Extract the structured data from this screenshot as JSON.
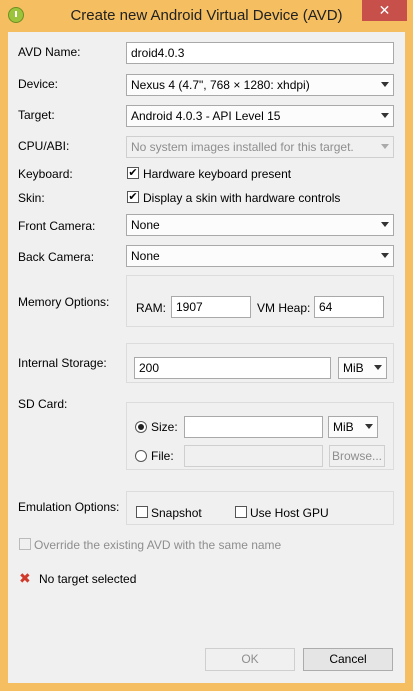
{
  "window": {
    "title": "Create new Android Virtual Device (AVD)",
    "close_glyph": "✕"
  },
  "labels": {
    "avd_name": "AVD Name:",
    "device": "Device:",
    "target": "Target:",
    "cpu_abi": "CPU/ABI:",
    "keyboard": "Keyboard:",
    "skin": "Skin:",
    "front_camera": "Front Camera:",
    "back_camera": "Back Camera:",
    "memory_options": "Memory Options:",
    "internal_storage": "Internal Storage:",
    "sd_card": "SD Card:",
    "emulation_options": "Emulation Options:"
  },
  "fields": {
    "avd_name": "droid4.0.3",
    "device": "Nexus 4 (4.7\", 768 × 1280: xhdpi)",
    "target": "Android 4.0.3 - API Level 15",
    "cpu_abi": "No system images installed for this target.",
    "front_camera": "None",
    "back_camera": "None"
  },
  "keyboard": {
    "label": "Hardware keyboard present",
    "checked": true
  },
  "skin": {
    "label": "Display a skin with hardware controls",
    "checked": true
  },
  "memory": {
    "ram_label": "RAM:",
    "ram_value": "1907",
    "vm_heap_label": "VM Heap:",
    "vm_heap_value": "64"
  },
  "internal_storage": {
    "value": "200",
    "unit": "MiB"
  },
  "sd_card": {
    "size_label": "Size:",
    "size_value": "",
    "size_unit": "MiB",
    "file_label": "File:",
    "file_value": "",
    "browse_label": "Browse...",
    "selected": "size"
  },
  "emulation": {
    "snapshot_label": "Snapshot",
    "use_host_gpu_label": "Use Host GPU"
  },
  "override": {
    "label": "Override the existing AVD with the same name",
    "checked": false
  },
  "status": {
    "message": "No target selected",
    "icon": "error-x-icon"
  },
  "buttons": {
    "ok": "OK",
    "cancel": "Cancel"
  },
  "colors": {
    "title_bar": "#f4be61",
    "close_button": "#c7504b",
    "error": "#d03a2a"
  }
}
